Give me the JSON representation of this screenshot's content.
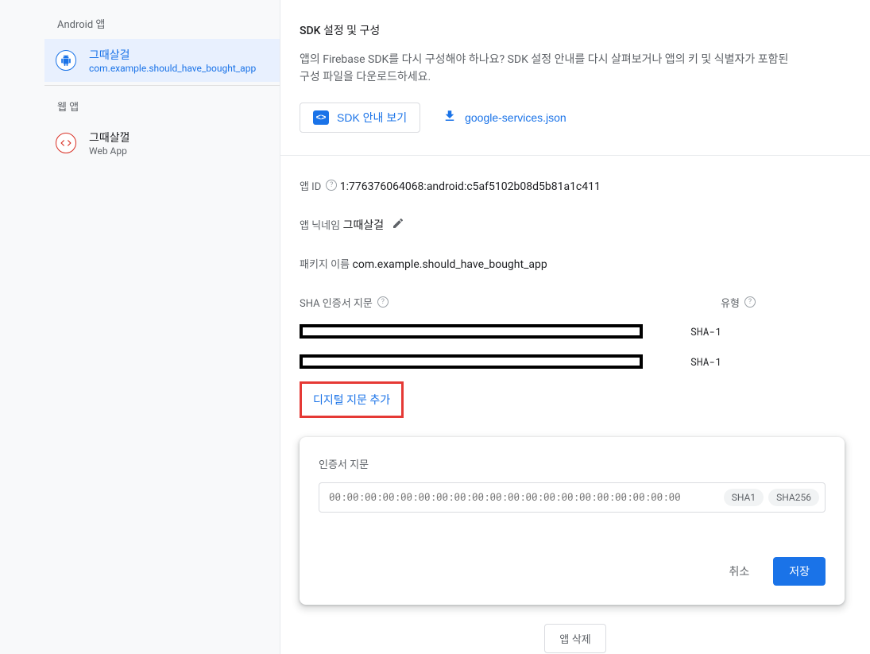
{
  "sidebar": {
    "android_header": "Android 앱",
    "web_header": "웹 앱",
    "android_app": {
      "title": "그때살걸",
      "subtitle": "com.example.should_have_bought_app"
    },
    "web_app": {
      "title": "그때살껄",
      "subtitle": "Web App"
    }
  },
  "sdk": {
    "title": "SDK 설정 및 구성",
    "desc": "앱의 Firebase SDK를 다시 구성해야 하나요? SDK 설정 안내를 다시 살펴보거나 앱의 키 및 식별자가 포함된 구성 파일을 다운로드하세요.",
    "guide_button": "SDK 안내 보기",
    "download_button": "google-services.json"
  },
  "app_id": {
    "label": "앱 ID",
    "value": "1:776376064068:android:c5af5102b08d5b81a1c411"
  },
  "nickname": {
    "label": "앱 닉네임",
    "value": "그때살걸"
  },
  "package": {
    "label": "패키지 이름",
    "value": "com.example.should_have_bought_app"
  },
  "sha": {
    "label": "SHA 인증서 지문",
    "type_label": "유형",
    "rows": [
      {
        "type": "SHA-1"
      },
      {
        "type": "SHA-1"
      }
    ],
    "add_label": "디지털 지문 추가"
  },
  "fingerprint_form": {
    "label": "인증서 지문",
    "placeholder": "00:00:00:00:00:00:00:00:00:00:00:00:00:00:00:00:00:00:00:00",
    "chip1": "SHA1",
    "chip2": "SHA256",
    "cancel": "취소",
    "save": "저장"
  },
  "delete_label": "앱 삭제"
}
